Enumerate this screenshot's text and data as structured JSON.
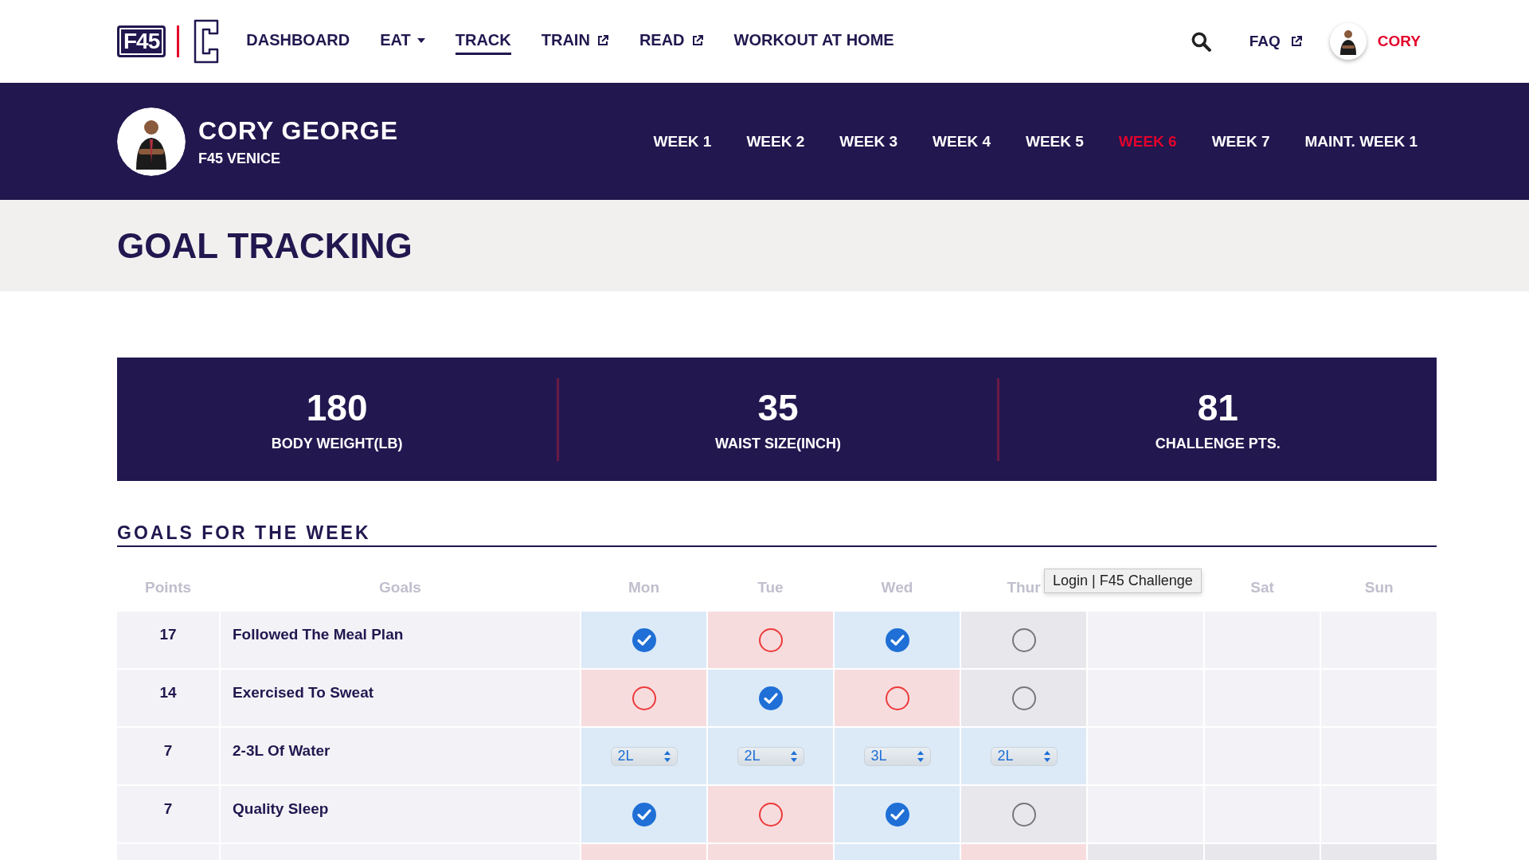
{
  "logo": {
    "text": "F45"
  },
  "nav": {
    "links": [
      {
        "label": "DASHBOARD",
        "selected": false,
        "kind": "plain"
      },
      {
        "label": "EAT",
        "selected": false,
        "kind": "dropdown"
      },
      {
        "label": "TRACK",
        "selected": true,
        "kind": "plain"
      },
      {
        "label": "TRAIN",
        "selected": false,
        "kind": "external"
      },
      {
        "label": "READ",
        "selected": false,
        "kind": "external"
      },
      {
        "label": "WORKOUT AT HOME",
        "selected": false,
        "kind": "plain"
      }
    ],
    "faq": {
      "label": "FAQ"
    },
    "user": {
      "name": "CORY"
    }
  },
  "profile": {
    "name": "CORY GEORGE",
    "studio": "F45 VENICE"
  },
  "weeks": [
    {
      "label": "WEEK 1",
      "selected": false
    },
    {
      "label": "WEEK 2",
      "selected": false
    },
    {
      "label": "WEEK 3",
      "selected": false
    },
    {
      "label": "WEEK 4",
      "selected": false
    },
    {
      "label": "WEEK 5",
      "selected": false
    },
    {
      "label": "WEEK 6",
      "selected": true
    },
    {
      "label": "WEEK 7",
      "selected": false
    },
    {
      "label": "MAINT. WEEK 1",
      "selected": false
    }
  ],
  "page_title": "GOAL TRACKING",
  "stats": [
    {
      "value": "180",
      "label": "BODY WEIGHT(LB)"
    },
    {
      "value": "35",
      "label": "WAIST SIZE(INCH)"
    },
    {
      "value": "81",
      "label": "CHALLENGE PTS."
    }
  ],
  "goals": {
    "title": "GOALS FOR THE WEEK",
    "columns": [
      "Points",
      "Goals",
      "Mon",
      "Tue",
      "Wed",
      "Thur",
      null,
      "Sat",
      "Sun"
    ],
    "rows": [
      {
        "points": "17",
        "goal": "Followed The Meal Plan",
        "cells": [
          {
            "kind": "check",
            "checked": true,
            "color": "#dceaf7"
          },
          {
            "kind": "check",
            "checked": false,
            "missed": true,
            "color": "#f7dcde"
          },
          {
            "kind": "check",
            "checked": true,
            "color": "#dceaf7"
          },
          {
            "kind": "check",
            "checked": false,
            "missed": false,
            "color": "#e8e7ec"
          },
          {
            "kind": "blank",
            "color": "#f3f3f7"
          },
          {
            "kind": "blank",
            "color": "#f3f3f7"
          },
          {
            "kind": "blank",
            "color": "#f3f3f7"
          }
        ]
      },
      {
        "points": "14",
        "goal": "Exercised To Sweat",
        "cells": [
          {
            "kind": "check",
            "checked": false,
            "missed": true,
            "color": "#f7dcde"
          },
          {
            "kind": "check",
            "checked": true,
            "color": "#dceaf7"
          },
          {
            "kind": "check",
            "checked": false,
            "missed": true,
            "color": "#f7dcde"
          },
          {
            "kind": "check",
            "checked": false,
            "missed": false,
            "color": "#e8e7ec"
          },
          {
            "kind": "blank",
            "color": "#f3f3f7"
          },
          {
            "kind": "blank",
            "color": "#f3f3f7"
          },
          {
            "kind": "blank",
            "color": "#f3f3f7"
          }
        ]
      },
      {
        "points": "7",
        "goal": "2-3L Of Water",
        "cells": [
          {
            "kind": "select",
            "value": "2L",
            "color": "#dceaf7"
          },
          {
            "kind": "select",
            "value": "2L",
            "color": "#dceaf7"
          },
          {
            "kind": "select",
            "value": "3L",
            "color": "#dceaf7"
          },
          {
            "kind": "select",
            "value": "2L",
            "color": "#dceaf7"
          },
          {
            "kind": "blank",
            "color": "#f3f3f7"
          },
          {
            "kind": "blank",
            "color": "#f3f3f7"
          },
          {
            "kind": "blank",
            "color": "#f3f3f7"
          }
        ]
      },
      {
        "points": "7",
        "goal": "Quality Sleep",
        "cells": [
          {
            "kind": "check",
            "checked": true,
            "color": "#dceaf7"
          },
          {
            "kind": "check",
            "checked": false,
            "missed": true,
            "color": "#f7dcde"
          },
          {
            "kind": "check",
            "checked": true,
            "color": "#dceaf7"
          },
          {
            "kind": "check",
            "checked": false,
            "missed": false,
            "color": "#e8e7ec"
          },
          {
            "kind": "blank",
            "color": "#f3f3f7"
          },
          {
            "kind": "blank",
            "color": "#f3f3f7"
          },
          {
            "kind": "blank",
            "color": "#f3f3f7"
          }
        ]
      },
      {
        "cells": [
          {
            "kind": "blank",
            "color": "#f7dcde"
          },
          {
            "kind": "blank",
            "color": "#f7dcde"
          },
          {
            "kind": "blank",
            "color": "#dceaf7"
          },
          {
            "kind": "blank",
            "color": "#f7dcde"
          },
          {
            "kind": "blank",
            "color": "#e8e7ec"
          },
          {
            "kind": "blank",
            "color": "#e8e7ec"
          },
          {
            "kind": "blank",
            "color": "#e8e7ec"
          }
        ]
      }
    ]
  },
  "tooltip": "Login | F45 Challenge"
}
